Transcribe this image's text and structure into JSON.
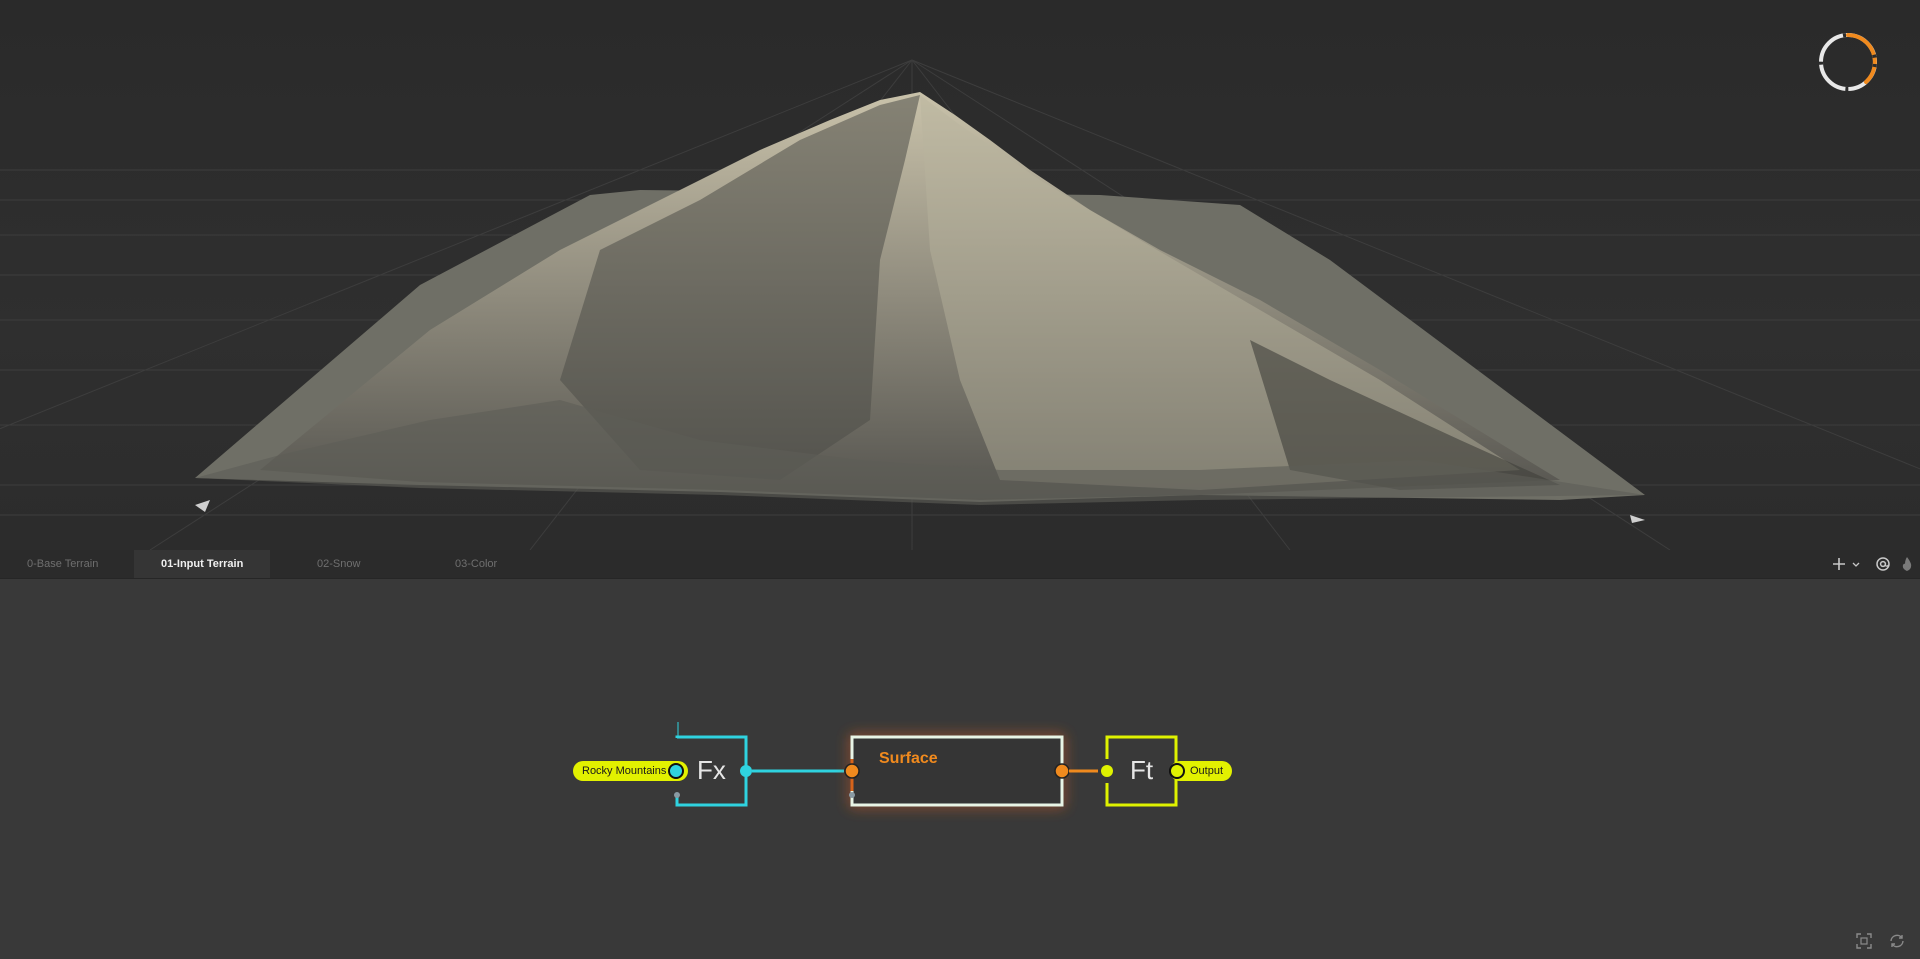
{
  "tabs": [
    {
      "label": "0-Base Terrain",
      "active": false
    },
    {
      "label": "01-Input Terrain",
      "active": true
    },
    {
      "label": "02-Snow",
      "active": false
    },
    {
      "label": "03-Color",
      "active": false
    }
  ],
  "toolbar": {
    "icons": [
      "plus-icon",
      "chevron-down-icon",
      "at-icon",
      "flame-icon"
    ]
  },
  "graph": {
    "input_pill": "Rocky Mountains",
    "fx_node": "Fx",
    "surface_node": "Surface",
    "ft_node": "Ft",
    "output_pill": "Output"
  },
  "colors": {
    "fx": "#2fd3e0",
    "surface_glow": "#e8650f",
    "surface_port": "#f08a1e",
    "ft": "#dff200",
    "pill": "#e2f100",
    "progress_arc": "#f08a1e"
  },
  "corner_icons": [
    "frame-icon",
    "refresh-icon"
  ]
}
